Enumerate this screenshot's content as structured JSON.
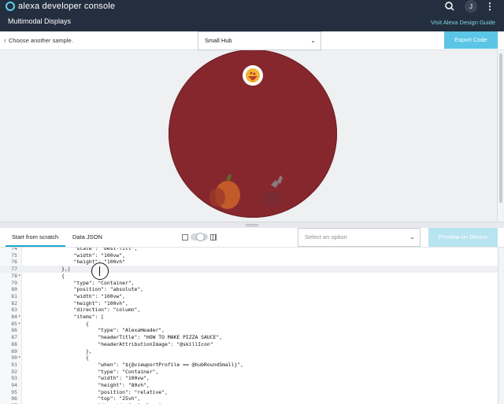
{
  "header": {
    "brand": "alexa developer console",
    "subtitle": "Multimodal Displays",
    "user_initial": "J",
    "visit_link": "Visit Alexa Design Guide",
    "accent": "#5fcfe8",
    "bg": "#232f3e"
  },
  "toolbar": {
    "back_label": "Choose another sample.",
    "device_selected": "Small Hub",
    "export_label": "Export Code"
  },
  "editor": {
    "tab_scratch": "Start from scratch",
    "tab_json": "Data JSON",
    "option_placeholder": "Select an option",
    "preview_label": "Preview on Device"
  },
  "code_lines": [
    {
      "n": "74",
      "fold": "",
      "text": "                \"scale\": \"best-fill\","
    },
    {
      "n": "75",
      "fold": "",
      "text": "                \"width\": \"100vw\","
    },
    {
      "n": "76",
      "fold": "",
      "text": "                \"height\": \"100vh\""
    },
    {
      "n": "77",
      "fold": "",
      "text": "            },|"
    },
    {
      "n": "78",
      "fold": "▾",
      "text": "            {"
    },
    {
      "n": "79",
      "fold": "",
      "text": "                \"type\": \"Container\","
    },
    {
      "n": "80",
      "fold": "",
      "text": "                \"position\": \"absolute\","
    },
    {
      "n": "81",
      "fold": "",
      "text": "                \"width\": \"100vw\","
    },
    {
      "n": "82",
      "fold": "",
      "text": "                \"height\": \"100vh\","
    },
    {
      "n": "83",
      "fold": "",
      "text": "                \"direction\": \"column\","
    },
    {
      "n": "84",
      "fold": "▾",
      "text": "                \"items\": ["
    },
    {
      "n": "85",
      "fold": "▾",
      "text": "                    {"
    },
    {
      "n": "86",
      "fold": "",
      "text": "                        \"type\": \"AlexaHeader\","
    },
    {
      "n": "87",
      "fold": "",
      "text": "                        \"headerTitle\": \"HOW TO MAKE PIZZA SAUCE\","
    },
    {
      "n": "88",
      "fold": "",
      "text": "                        \"headerAttributionImage\": \"@skillIcon\""
    },
    {
      "n": "89",
      "fold": "",
      "text": "                    },"
    },
    {
      "n": "90",
      "fold": "▾",
      "text": "                    {"
    },
    {
      "n": "91",
      "fold": "",
      "text": "                        \"when\": \"${@viewportProfile == @hubRoundSmall}\","
    },
    {
      "n": "92",
      "fold": "",
      "text": "                        \"type\": \"Container\","
    },
    {
      "n": "93",
      "fold": "",
      "text": "                        \"width\": \"100vw\","
    },
    {
      "n": "94",
      "fold": "",
      "text": "                        \"height\": \"80vh\","
    },
    {
      "n": "95",
      "fold": "",
      "text": "                        \"position\": \"relative\","
    },
    {
      "n": "96",
      "fold": "",
      "text": "                        \"top\": \"25vh\","
    },
    {
      "n": "97",
      "fold": "",
      "text": "                        \"direction\": \"column\""
    }
  ],
  "colors": {
    "hub_bg": "#86272e",
    "export_btn": "#5bc5e6",
    "tab_accent": "#1ea7c9"
  }
}
